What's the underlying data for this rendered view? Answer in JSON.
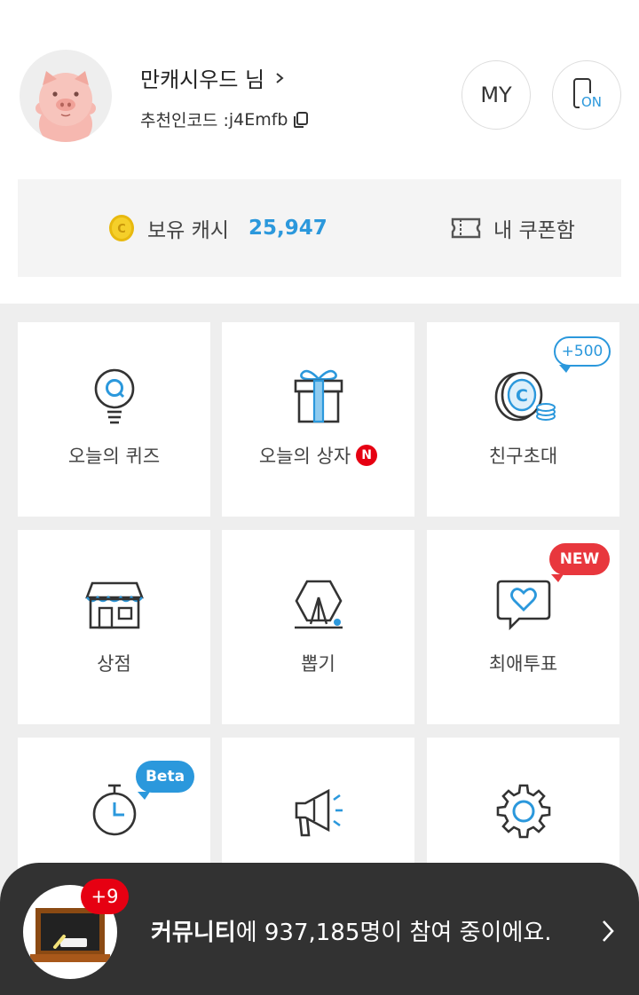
{
  "profile": {
    "name": "만캐시우드 님",
    "referral_label": "추천인코드 : ",
    "referral_code": "j4Emfb",
    "my_button": "MY",
    "on_badge": "ON"
  },
  "cash": {
    "label": "보유 캐시",
    "value": "25,947",
    "coin_letter": "C",
    "coupon_label": "내 쿠폰함"
  },
  "menu": {
    "tiles": [
      {
        "label": "오늘의 퀴즈",
        "icon": "quiz-lightbulb-icon"
      },
      {
        "label": "오늘의 상자",
        "icon": "gift-box-icon",
        "badge": "N"
      },
      {
        "label": "친구초대",
        "icon": "coin-stack-icon",
        "bubble": "+500"
      },
      {
        "label": "상점",
        "icon": "store-icon"
      },
      {
        "label": "뽑기",
        "icon": "claw-machine-icon"
      },
      {
        "label": "최애투표",
        "icon": "heart-chat-icon",
        "bubble": "NEW"
      },
      {
        "label": "",
        "icon": "stopwatch-icon",
        "bubble": "Beta"
      },
      {
        "label": "",
        "icon": "megaphone-icon"
      },
      {
        "label": "",
        "icon": "gear-icon"
      }
    ]
  },
  "community": {
    "badge": "+9",
    "title": "커뮤니티",
    "text": "에 937,185명이 참여 중이에요."
  },
  "colors": {
    "accent_blue": "#2b98dc",
    "badge_red": "#e60012",
    "bar_dark": "#323232"
  }
}
